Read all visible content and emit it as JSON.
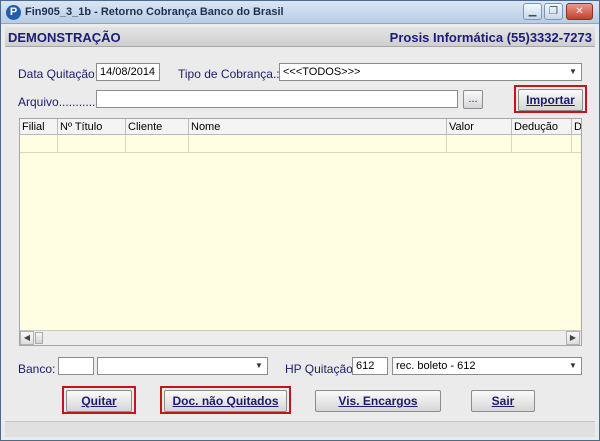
{
  "window": {
    "title": "Fin905_3_1b - Retorno Cobrança Banco do Brasil",
    "app_icon": "P",
    "minimize_icon": "minimize-icon",
    "restore_icon": "restore-icon",
    "close_icon": "close-icon"
  },
  "header": {
    "mode": "DEMONSTRAÇÃO",
    "company": "Prosis Informática (55)3332-7273"
  },
  "form": {
    "data_quitacao_label": "Data Quitação:",
    "data_quitacao_value": "14/08/2014",
    "tipo_cobranca_label": "Tipo de Cobrança.:",
    "tipo_cobranca_value": "<<<TODOS>>>",
    "arquivo_label": "Arquivo.............:",
    "arquivo_value": "",
    "browse_label": "...",
    "importar_label": "Importar",
    "banco_label": "Banco:",
    "banco_code": "",
    "banco_name": "",
    "hp_label": "HP Quitação:",
    "hp_code": "612",
    "hp_desc": "rec. boleto  - 612"
  },
  "grid": {
    "columns": [
      "Filial",
      "Nº Título",
      "Cliente",
      "Nome",
      "Valor",
      "Dedução",
      "D"
    ]
  },
  "buttons": {
    "quitar": "Quitar",
    "doc_nao_quitados": "Doc. não Quitados",
    "vis_encargos": "Vis. Encargos",
    "sair": "Sair"
  },
  "colors": {
    "grid_background": "#fffde2",
    "highlight": "#c0171b",
    "label_text": "#1c1c6c"
  }
}
